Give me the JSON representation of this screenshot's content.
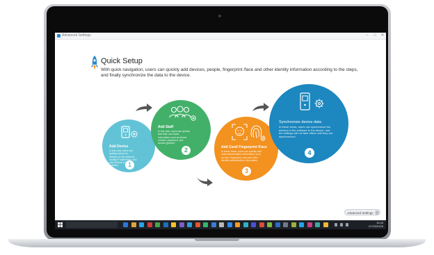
{
  "window": {
    "title": "Advanced Settings",
    "controls": [
      "–",
      "□",
      "✕"
    ]
  },
  "quick_setup": {
    "title": "Quick Setup",
    "description": "With quick navigation, users can quickly add devices, people, fingerprint /face and other identity information according to the steps, and finally synchronize the data to the device."
  },
  "steps": [
    {
      "title": "Add Device",
      "description": "In this view, users can quickly search for devices on the network, modify IP addresses, and add devices to the software.",
      "number": "1",
      "color": "#62c3d6",
      "icon": "device-add-icon"
    },
    {
      "title": "Add Staff",
      "description": "In this view, users can quickly add staff, and basic information such as device number, password, and access granted.",
      "number": "2",
      "color": "#43b06a",
      "icon": "people-add-icon"
    },
    {
      "title": "Add Card/ Fingerprint /Face",
      "description": "In these views, users can quickly add staff authentication information, such as face, fingerprint, card and other identity authentication information.",
      "number": "3",
      "color": "#f3921f",
      "icon": "face-fingerprint-icon"
    },
    {
      "title": "Synchronize device data",
      "description": "In these views, users can synchronize the devices in the software to the device, and the settings will not take effect until they are synchronized.",
      "number": "4",
      "color": "#1d87bf",
      "icon": "device-sync-icon"
    }
  ],
  "advanced_button": {
    "label": "Advanced Settings",
    "icon": "chevron-right-icon"
  },
  "taskbar": {
    "search_placeholder": "",
    "time": "15:45",
    "date": "2/7/2020/26",
    "apps": [
      "#2a78d6",
      "#e0a53a",
      "#2aa3e0",
      "#d23b3b",
      "#46a64a",
      "#1f6fbd",
      "#f2c12e",
      "#7c5cc9",
      "#2a9ed9",
      "#e0572f",
      "#35b56a",
      "#3a7bd5",
      "#b8b8b8",
      "#2d8cf0",
      "#f09a2a",
      "#2fb0c8",
      "#4a4fd6",
      "#dd4b39",
      "#7cbd3f",
      "#2c6ebf",
      "#6f7a85",
      "#9ab23c",
      "#21a5e2",
      "#cc3d86",
      "#3fa7a0",
      "#f2b63a"
    ]
  }
}
